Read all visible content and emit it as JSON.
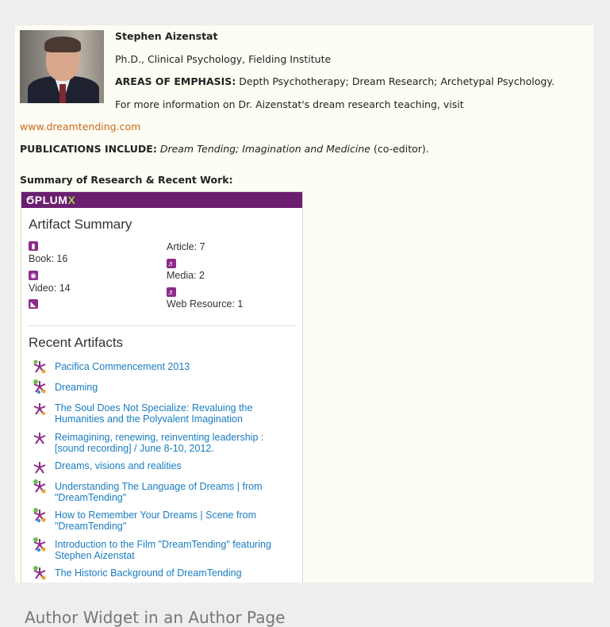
{
  "author": {
    "name": "Stephen Aizenstat",
    "degree": "Ph.D., Clinical Psychology, Fielding Institute",
    "emphasis_label": "AREAS OF EMPHASIS:",
    "emphasis_text": " Depth Psychotherapy; Dream Research; Archetypal Psychology.",
    "more_info": "For more information on Dr. Aizenstat's dream research teaching, visit",
    "website": "www.dreamtending.com",
    "publications_label": "PUBLICATIONS INCLUDE:",
    "publications_italic": "Dream Tending; Imagination and Medicine",
    "publications_suffix": " (co-editor).",
    "summary_heading": "Summary of Research & Recent Work:"
  },
  "widget": {
    "logo_plum": "PLUM",
    "logo_x": "X",
    "artifact_summary_title": "Artifact Summary",
    "book": "Book: 16",
    "video": "Video: 14",
    "article": "Article: 7",
    "media": "Media: 2",
    "web_resource": "Web Resource: 1",
    "recent_title": "Recent Artifacts",
    "colors": {
      "bar": "#6b1e70",
      "icon": "#8d2b8a",
      "link": "#1a7cc0",
      "accent": "#9fd13f"
    },
    "artifacts": [
      "Pacifica Commencement 2013",
      "Dreaming",
      "The Soul Does Not Specialize: Revaluing the Humanities and the Polyvalent Imagination",
      "Reimagining, renewing, reinventing leadership : [sound recording] / June 8-10, 2012.",
      "Dreams, visions and realities",
      "Understanding The Language of Dreams | from \"DreamTending\"",
      "How to Remember Your Dreams | Scene from \"DreamTending\"",
      "Introduction to the Film \"DreamTending\" featuring Stephen Aizenstat",
      "The Historic Background of DreamTending"
    ]
  },
  "caption": "Author Widget in an Author Page"
}
